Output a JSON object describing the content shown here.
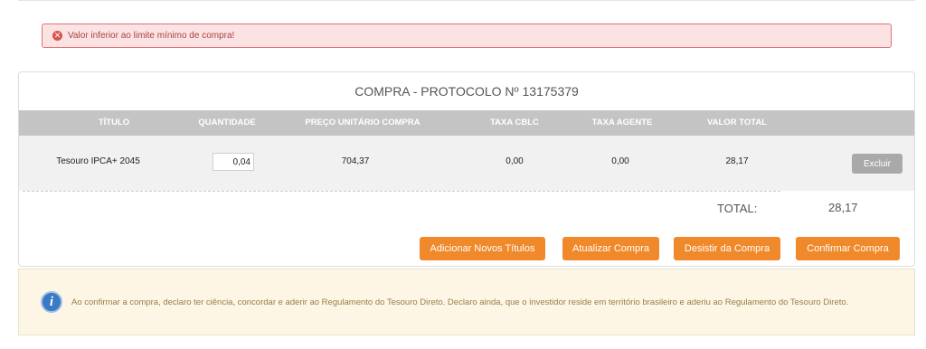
{
  "alert": {
    "message": "Valor inferior ao limite mínimo de compra!",
    "icon": "error-icon",
    "color": "#d9534f"
  },
  "panel": {
    "title": "COMPRA - PROTOCOLO Nº 13175379",
    "headers": [
      "TÍTULO",
      "QUANTIDADE",
      "PREÇO UNITÁRIO COMPRA",
      "TAXA CBLC",
      "TAXA AGENTE",
      "VALOR TOTAL"
    ],
    "row": {
      "titulo": "Tesouro IPCA+ 2045",
      "quantidade": "0,04",
      "preco": "704,37",
      "taxa_cblc": "0,00",
      "taxa_agente": "0,00",
      "valor_total": "28,17",
      "excluir_label": "Excluir"
    },
    "total_label": "TOTAL:",
    "total_value": "28,17"
  },
  "actions": {
    "adicionar": "Adicionar Novos Títulos",
    "atualizar": "Atualizar Compra",
    "desistir": "Desistir da Compra",
    "confirmar": "Confirmar Compra",
    "accent": "#f0892a"
  },
  "info": {
    "icon": "info-icon",
    "text": "Ao confirmar a compra, declaro ter ciência, concordar e aderir ao Regulamento do Tesouro Direto. Declaro ainda, que o investidor reside em território brasileiro e aderiu ao Regulamento do Tesouro Direto."
  }
}
